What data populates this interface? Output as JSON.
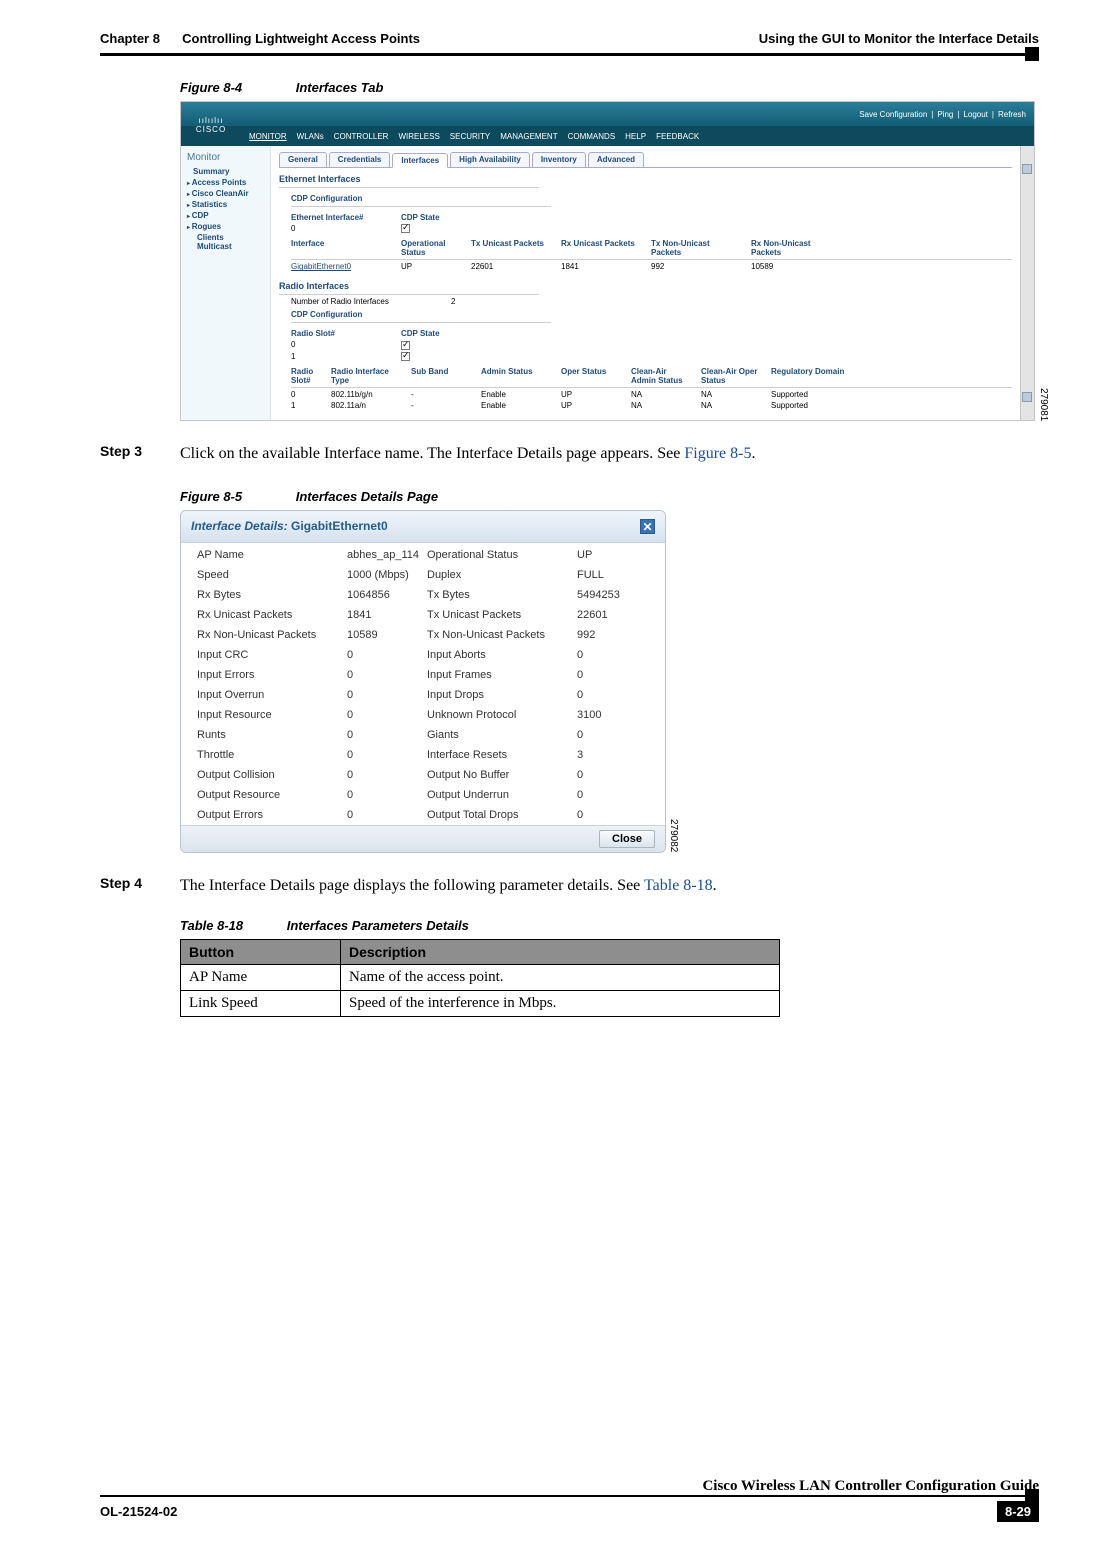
{
  "header": {
    "chapter_ref": "Chapter 8",
    "chapter_title": "Controlling Lightweight Access Points",
    "section_title": "Using the GUI to Monitor the Interface Details"
  },
  "footer": {
    "doc_id": "OL-21524-02",
    "book_title": "Cisco Wireless LAN Controller Configuration Guide",
    "page_num": "8-29"
  },
  "figure84": {
    "label": "Figure 8-4",
    "title": "Interfaces Tab",
    "image_id": "279081",
    "app": {
      "top_links": [
        "Save Configuration",
        "Ping",
        "Logout",
        "Refresh"
      ],
      "logo_text": "CISCO",
      "menu": [
        "MONITOR",
        "WLANs",
        "CONTROLLER",
        "WIRELESS",
        "SECURITY",
        "MANAGEMENT",
        "COMMANDS",
        "HELP",
        "FEEDBACK"
      ],
      "sidebar": {
        "title": "Monitor",
        "items": [
          "Summary",
          "Access Points",
          "Cisco CleanAir",
          "Statistics",
          "CDP",
          "Rogues",
          "Clients",
          "Multicast"
        ]
      },
      "tabs": [
        "General",
        "Credentials",
        "Interfaces",
        "High Availability",
        "Inventory",
        "Advanced"
      ],
      "active_tab": "Interfaces",
      "eth_section_title": "Ethernet Interfaces",
      "cdp_config_label": "CDP Configuration",
      "eth_cols1": [
        "Ethernet Interface#",
        "CDP State"
      ],
      "eth_row_cdp": {
        "iface": "0"
      },
      "eth_cols2": [
        "Interface",
        "Operational Status",
        "Tx Unicast Packets",
        "Rx Unicast Packets",
        "Tx Non-Unicast Packets",
        "Rx Non-Unicast Packets"
      ],
      "eth_row": {
        "iface": "GigabitEthernet0",
        "oper": "UP",
        "txu": "22601",
        "rxu": "1841",
        "txn": "992",
        "rxn": "10589"
      },
      "radio_section_title": "Radio Interfaces",
      "radio_count_label": "Number of Radio Interfaces",
      "radio_count": "2",
      "radio_cols1": [
        "Radio Slot#",
        "CDP State"
      ],
      "radio_cdp_rows": [
        {
          "slot": "0"
        },
        {
          "slot": "1"
        }
      ],
      "radio_cols2": [
        "Radio Slot#",
        "Radio Interface Type",
        "Sub Band",
        "Admin Status",
        "Oper Status",
        "Clean-Air Admin Status",
        "Clean-Air Oper Status",
        "Regulatory Domain"
      ],
      "radio_rows": [
        {
          "slot": "0",
          "type": "802.11b/g/n",
          "sub": "-",
          "admin": "Enable",
          "oper": "UP",
          "ca_admin": "NA",
          "ca_oper": "NA",
          "reg": "Supported"
        },
        {
          "slot": "1",
          "type": "802.11a/n",
          "sub": "-",
          "admin": "Enable",
          "oper": "UP",
          "ca_admin": "NA",
          "ca_oper": "NA",
          "reg": "Supported"
        }
      ]
    }
  },
  "step3": {
    "label": "Step 3",
    "text_pre": "Click on the available Interface name. The Interface Details page appears. See ",
    "xref": "Figure 8-5",
    "text_post": "."
  },
  "figure85": {
    "label": "Figure 8-5",
    "title": "Interfaces Details Page",
    "image_id": "279082",
    "dialog": {
      "title_label": "Interface Details:",
      "iface_name": "GigabitEthernet0",
      "close_btn": "Close",
      "rows": [
        {
          "l1": "AP Name",
          "v1": "abhes_ap_114",
          "l2": "Operational Status",
          "v2": "UP"
        },
        {
          "l1": "Speed",
          "v1": "1000 (Mbps)",
          "l2": "Duplex",
          "v2": "FULL"
        },
        {
          "l1": "Rx Bytes",
          "v1": "1064856",
          "l2": "Tx Bytes",
          "v2": "5494253"
        },
        {
          "l1": "Rx Unicast Packets",
          "v1": "1841",
          "l2": "Tx Unicast Packets",
          "v2": "22601"
        },
        {
          "l1": "Rx Non-Unicast Packets",
          "v1": "10589",
          "l2": "Tx Non-Unicast Packets",
          "v2": "992"
        },
        {
          "l1": "Input CRC",
          "v1": "0",
          "l2": "Input Aborts",
          "v2": "0"
        },
        {
          "l1": "Input Errors",
          "v1": "0",
          "l2": "Input Frames",
          "v2": "0"
        },
        {
          "l1": "Input Overrun",
          "v1": "0",
          "l2": "Input Drops",
          "v2": "0"
        },
        {
          "l1": "Input Resource",
          "v1": "0",
          "l2": "Unknown Protocol",
          "v2": "3100"
        },
        {
          "l1": "Runts",
          "v1": "0",
          "l2": "Giants",
          "v2": "0"
        },
        {
          "l1": "Throttle",
          "v1": "0",
          "l2": "Interface Resets",
          "v2": "3"
        },
        {
          "l1": "Output Collision",
          "v1": "0",
          "l2": "Output No Buffer",
          "v2": "0"
        },
        {
          "l1": "Output Resource",
          "v1": "0",
          "l2": "Output Underrun",
          "v2": "0"
        },
        {
          "l1": "Output Errors",
          "v1": "0",
          "l2": "Output Total Drops",
          "v2": "0"
        }
      ]
    }
  },
  "step4": {
    "label": "Step 4",
    "text_pre": "The Interface Details page displays the following parameter details. See ",
    "xref": "Table 8-18",
    "text_post": "."
  },
  "table818": {
    "label": "Table 8-18",
    "title": "Interfaces Parameters Details",
    "cols": [
      "Button",
      "Description"
    ],
    "rows": [
      {
        "b": "AP Name",
        "d": "Name of the access point."
      },
      {
        "b": "Link Speed",
        "d": "Speed of the interference in Mbps."
      }
    ]
  }
}
